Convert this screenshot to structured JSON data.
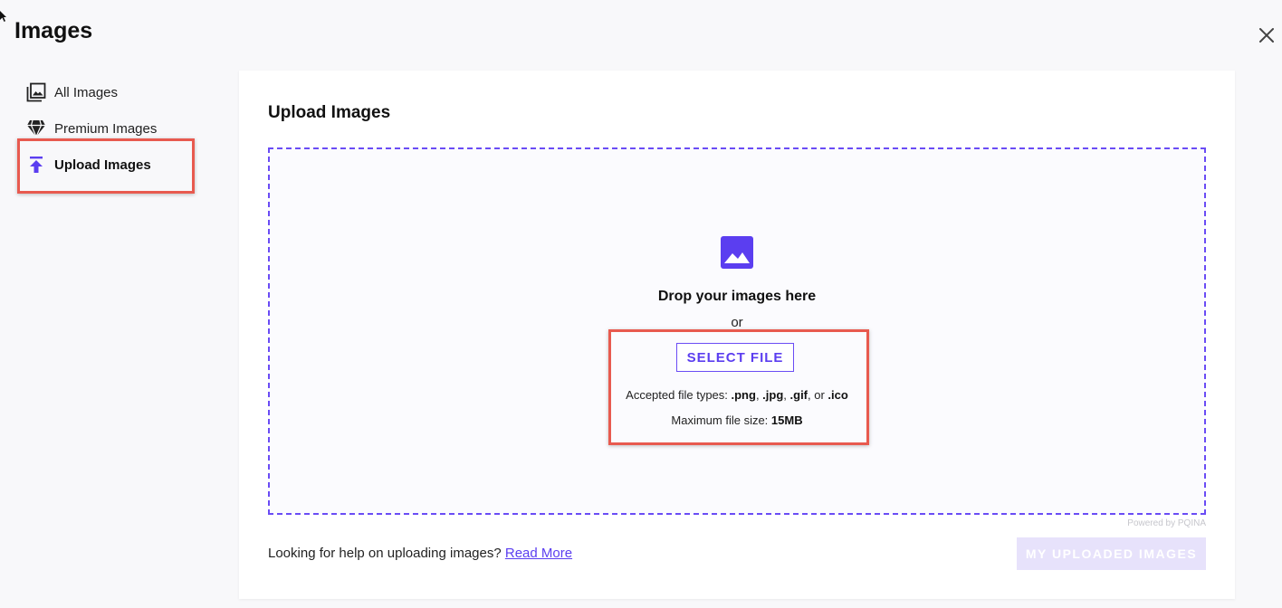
{
  "header": {
    "title": "Images",
    "close_icon": "close-icon"
  },
  "sidebar": {
    "items": [
      {
        "label": "All Images",
        "icon": "image-stack-icon",
        "active": false
      },
      {
        "label": "Premium Images",
        "icon": "diamond-icon",
        "active": false
      },
      {
        "label": "Upload Images",
        "icon": "upload-arrow-icon",
        "active": true
      }
    ]
  },
  "upload": {
    "title": "Upload Images",
    "drop_icon": "image-icon",
    "drop_text": "Drop your images here",
    "or_text": "or",
    "select_button": "SELECT FILE",
    "accepted_prefix": "Accepted file types: ",
    "types": [
      ".png",
      ".jpg",
      ".gif",
      ".ico"
    ],
    "sep_comma": ", ",
    "sep_or": ", or ",
    "max_prefix": "Maximum file size: ",
    "max_size": "15MB",
    "powered_by": "Powered by PQINA"
  },
  "footer": {
    "help_text": "Looking for help on uploading images?",
    "help_link": "Read More",
    "uploaded_button": "MY UPLOADED IMAGES"
  },
  "colors": {
    "accent": "#5b3ef0",
    "highlight": "#e85a4f",
    "disabled_button": "#e7e2fb"
  }
}
